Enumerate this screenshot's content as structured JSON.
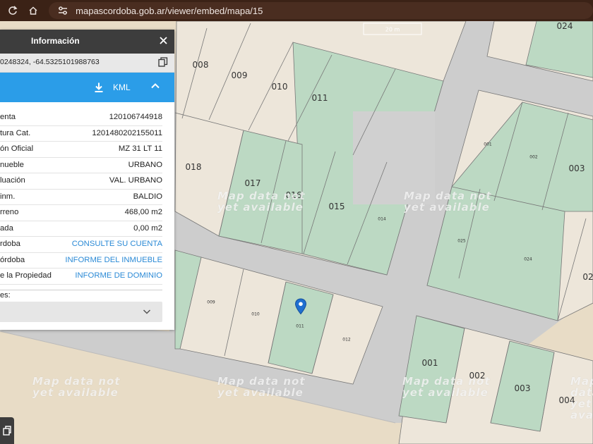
{
  "browser": {
    "url": "mapascordoba.gob.ar/viewer/embed/mapa/15",
    "url_icon": "tune-icon"
  },
  "map": {
    "scale_label": "20 m",
    "watermark_line1": "Map data not",
    "watermark_line2": "yet available",
    "marker_icon": "map-pin-icon",
    "lots_big": [
      "024",
      "008",
      "009",
      "010",
      "011",
      "018",
      "017",
      "016",
      "015",
      "003",
      "02",
      "001",
      "002",
      "003",
      "004"
    ],
    "lots_small": [
      "001",
      "002",
      "014",
      "025",
      "024",
      "009",
      "010",
      "011",
      "012"
    ]
  },
  "panel": {
    "title": "Información",
    "coords": "0248324, -64.5325101988763",
    "kml_label": "KML",
    "rows": [
      {
        "key": "enta",
        "value": "120106744918",
        "link": false
      },
      {
        "key": "tura Cat.",
        "value": "1201480202155011",
        "link": false
      },
      {
        "key": "ón Oficial",
        "value": "MZ 31 LT 11",
        "link": false
      },
      {
        "key": "nueble",
        "value": "URBANO",
        "link": false
      },
      {
        "key": "luación",
        "value": "VAL. URBANO",
        "link": false
      },
      {
        "key": " inm.",
        "value": "BALDIO",
        "link": false
      },
      {
        "key": "rreno",
        "value": "468,00 m2",
        "link": false
      },
      {
        "key": "ada",
        "value": "0,00 m2",
        "link": false
      },
      {
        "key": "rdoba",
        "value": "CONSULTE SU CUENTA",
        "link": true
      },
      {
        "key": "órdoba",
        "value": "INFORME DEL INMUEBLE",
        "link": true
      },
      {
        "key": "e la Propiedad",
        "value": "INFORME DE DOMINIO",
        "link": true
      }
    ],
    "notes_label": "es:"
  },
  "colors": {
    "browser_bar": "#3b2216",
    "panel_header": "#3d3d3d",
    "accent_blue": "#2b9de8",
    "link_blue": "#2b8ad6",
    "lot_green": "#bcd9c3",
    "lot_beige": "#ede6da",
    "road_gray": "#cdcdcd",
    "sand": "#e8dcc6"
  }
}
